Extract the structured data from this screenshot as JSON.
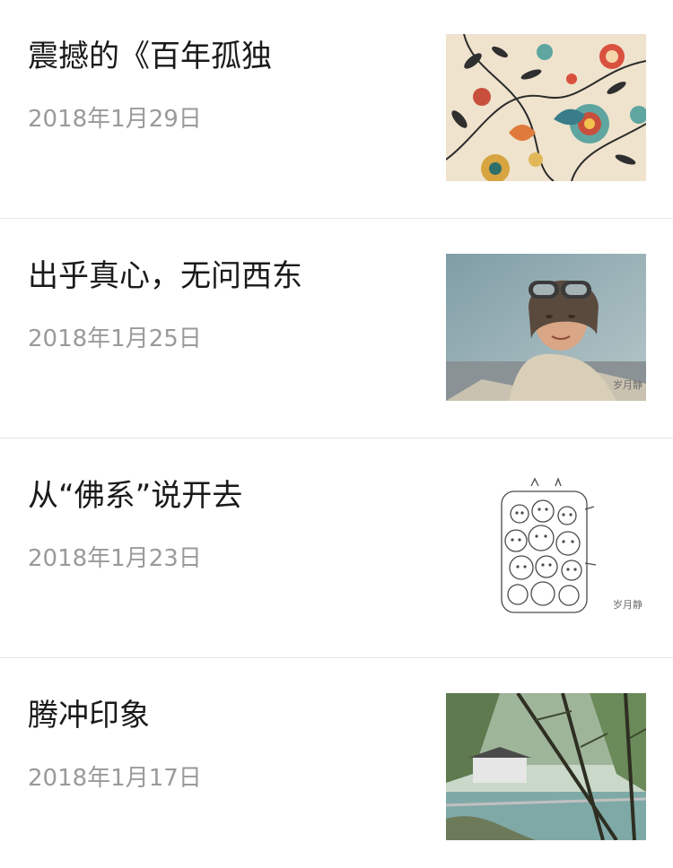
{
  "articles": [
    {
      "title": "震撼的《百年孤独",
      "date": "2018年1月29日",
      "thumb_icon": "floral-pattern-thumbnail"
    },
    {
      "title": "出乎真心，无问西东",
      "date": "2018年1月25日",
      "thumb_icon": "pilot-portrait-thumbnail",
      "watermark": "岁月静"
    },
    {
      "title": "从“佛系”说开去",
      "date": "2018年1月23日",
      "thumb_icon": "doodle-faces-thumbnail",
      "watermark": "岁月静"
    },
    {
      "title": "腾冲印象",
      "date": "2018年1月17日",
      "thumb_icon": "bamboo-river-thumbnail"
    }
  ]
}
